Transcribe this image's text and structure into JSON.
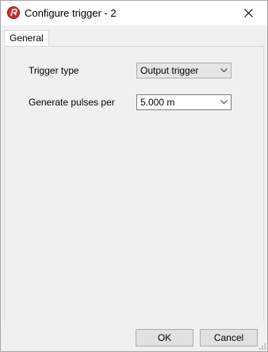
{
  "window": {
    "title": "Configure trigger - 2",
    "app_icon": "app-logo-icon",
    "close_icon": "close-icon"
  },
  "tabs": [
    {
      "label": "General",
      "selected": true
    }
  ],
  "general": {
    "trigger_type": {
      "label": "Trigger type",
      "value": "Output trigger"
    },
    "generate_pulses": {
      "label": "Generate pulses per",
      "value": "5.000 m"
    }
  },
  "footer": {
    "ok_label": "OK",
    "cancel_label": "Cancel",
    "resize_grip_icon": "resize-grip-icon"
  },
  "colors": {
    "app_icon_red": "#c8302c",
    "window_bg": "#f0f0f0",
    "titlebar_bg": "#ffffff"
  }
}
